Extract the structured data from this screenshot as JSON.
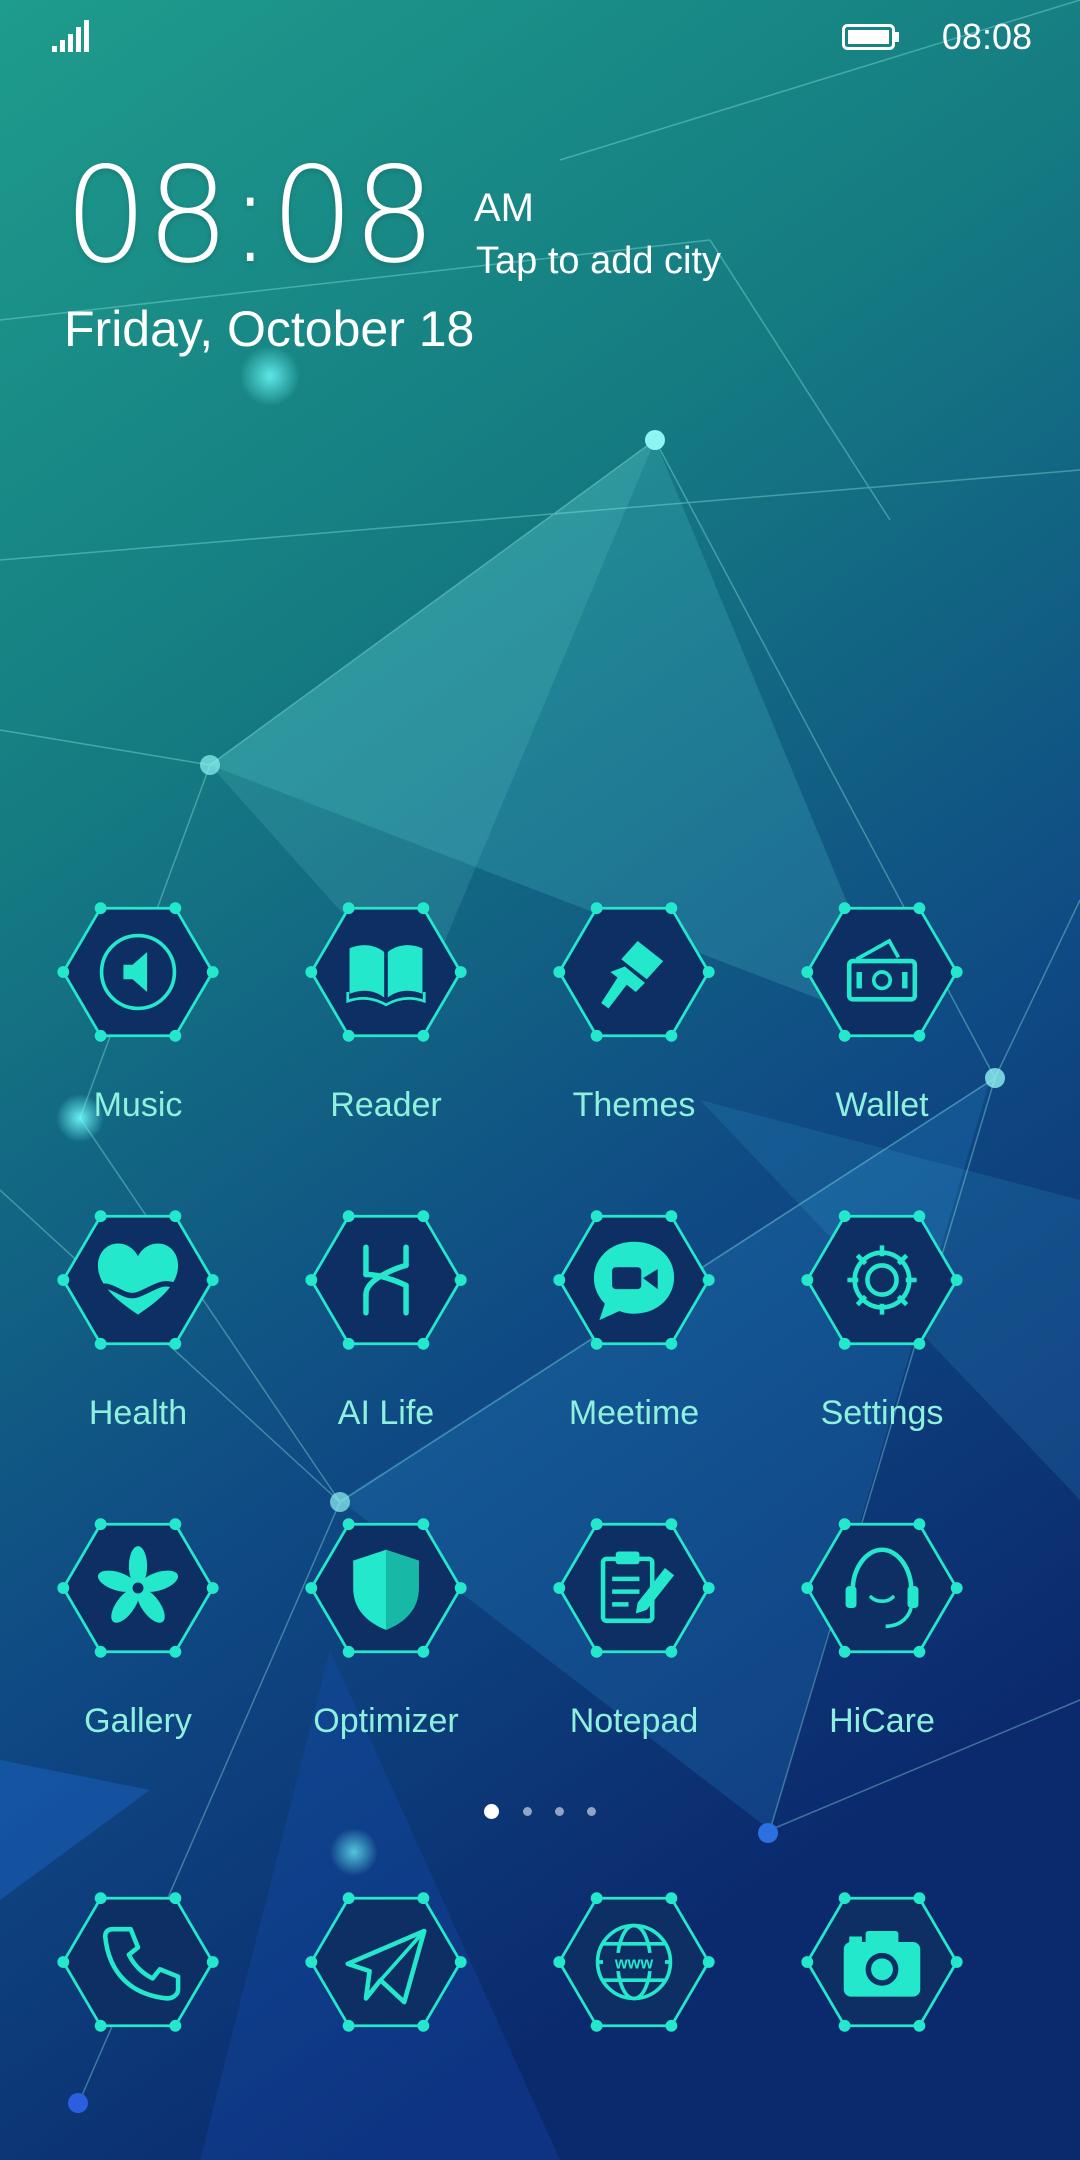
{
  "status_bar": {
    "time": "08:08"
  },
  "clock": {
    "time": "08:08",
    "ampm": "AM",
    "city_prompt": "Tap to add city",
    "date": "Friday, October 18"
  },
  "apps": [
    {
      "label": "Music",
      "icon": "music-icon"
    },
    {
      "label": "Reader",
      "icon": "book-icon"
    },
    {
      "label": "Themes",
      "icon": "paintbrush-icon"
    },
    {
      "label": "Wallet",
      "icon": "wallet-icon"
    },
    {
      "label": "Health",
      "icon": "heart-icon"
    },
    {
      "label": "AI Life",
      "icon": "ai-life-icon"
    },
    {
      "label": "Meetime",
      "icon": "video-chat-icon"
    },
    {
      "label": "Settings",
      "icon": "gear-icon"
    },
    {
      "label": "Gallery",
      "icon": "flower-icon"
    },
    {
      "label": "Optimizer",
      "icon": "shield-icon"
    },
    {
      "label": "Notepad",
      "icon": "notepad-icon"
    },
    {
      "label": "HiCare",
      "icon": "headset-icon"
    }
  ],
  "dock": [
    {
      "icon": "phone-icon"
    },
    {
      "icon": "paper-plane-icon"
    },
    {
      "icon": "globe-www-icon"
    },
    {
      "icon": "camera-icon"
    }
  ],
  "page_indicator": {
    "pages": 4,
    "current": 1
  },
  "colors": {
    "accent": "#23e8cc",
    "hex_fill": "#0d2f63",
    "label": "#8ff0dc"
  }
}
